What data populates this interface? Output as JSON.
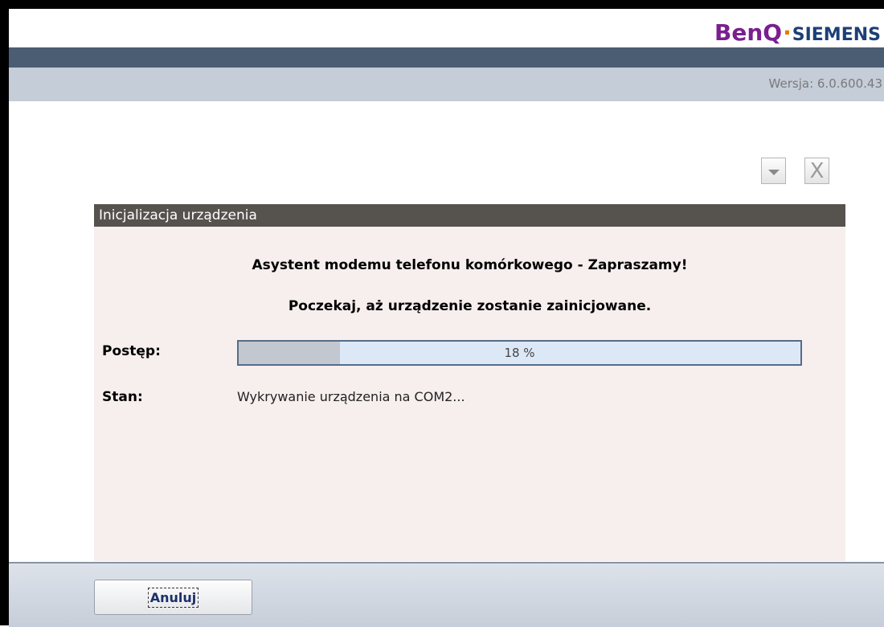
{
  "brand": {
    "benq": "BenQ",
    "separator": "·",
    "siemens": "SIEMENS"
  },
  "version": "Wersja: 6.0.600.43",
  "window_controls": {
    "minimize_icon": "chevron-down-icon",
    "close_label": "X"
  },
  "panel": {
    "title": "Inicjalizacja urządzenia",
    "welcome": "Asystent modemu telefonu komórkowego - Zapraszamy!",
    "wait_message": "Poczekaj, aż urządzenie zostanie zainicjowane.",
    "progress_label": "Postęp:",
    "progress_value": 0.18,
    "progress_text": "18 %",
    "status_label": "Stan:",
    "status_value": "Wykrywanie urządzenia na COM2..."
  },
  "footer": {
    "cancel_label": "Anuluj"
  },
  "colors": {
    "header_dark": "#4b5d72",
    "header_light": "#c4cdd8",
    "panel_bg": "#f7eeee",
    "panel_title_bg": "#56524e",
    "progress_border": "#556d88",
    "progress_track": "#dde8f7",
    "progress_fill": "#c3c7cf"
  }
}
